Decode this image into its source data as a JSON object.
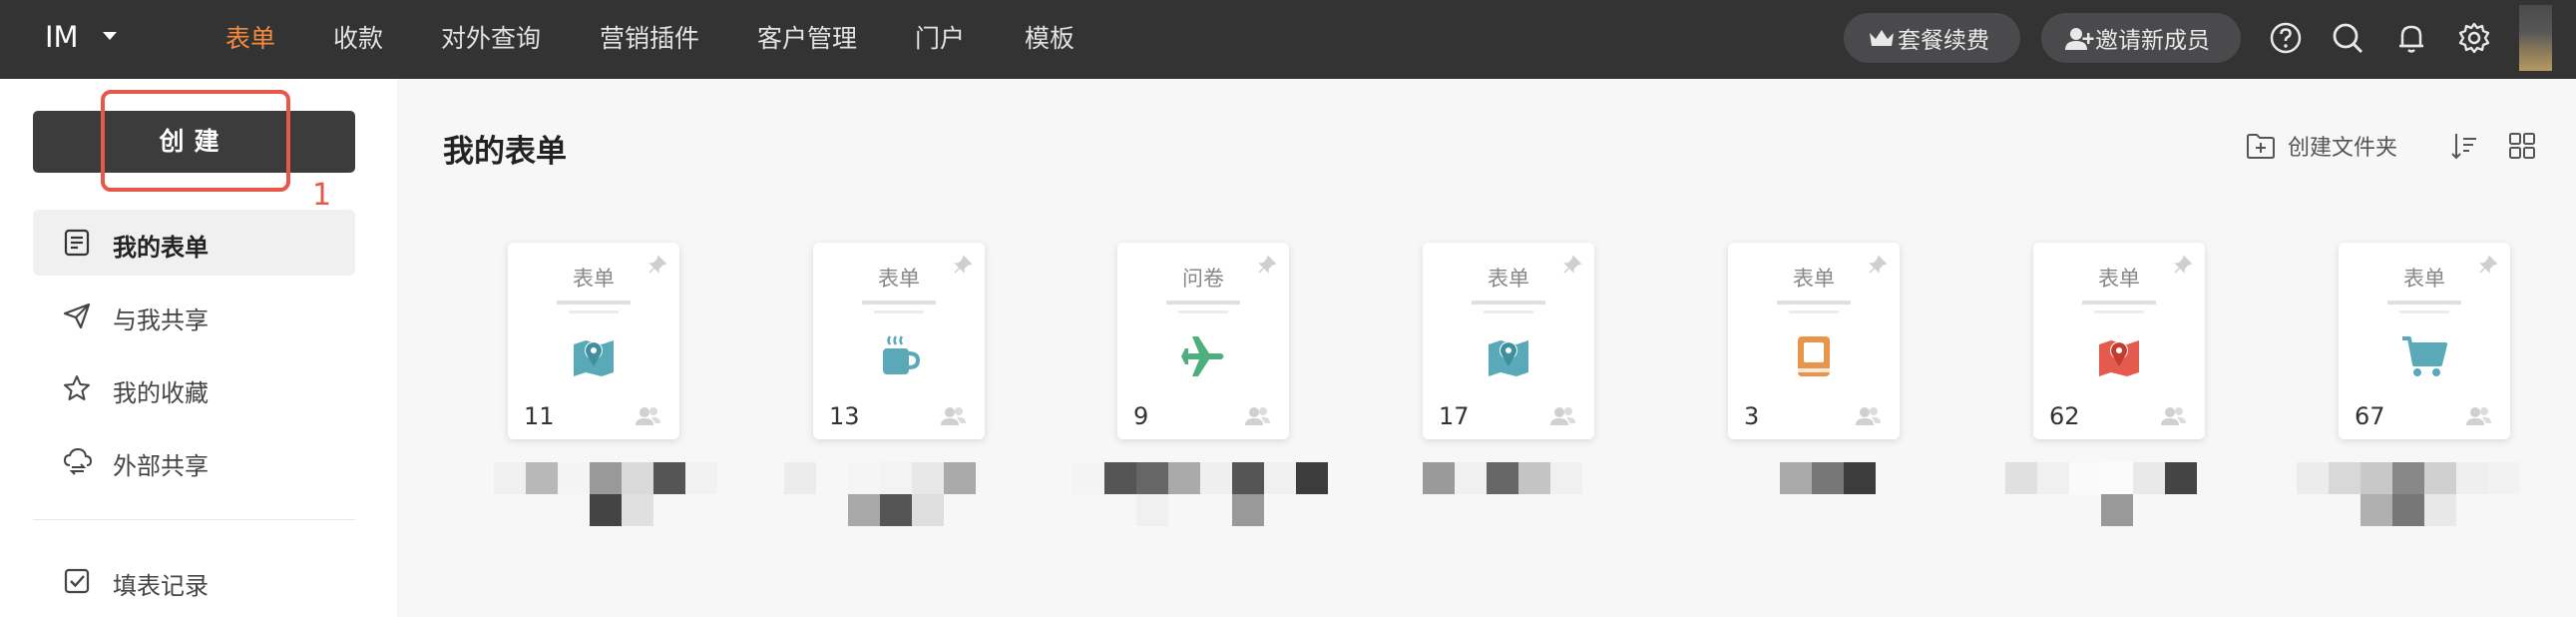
{
  "topbar": {
    "brand": "IM",
    "nav": [
      {
        "label": "表单",
        "active": true
      },
      {
        "label": "收款",
        "active": false
      },
      {
        "label": "对外查询",
        "active": false
      },
      {
        "label": "营销插件",
        "active": false
      },
      {
        "label": "客户管理",
        "active": false
      },
      {
        "label": "门户",
        "active": false
      },
      {
        "label": "模板",
        "active": false
      }
    ],
    "plan_button": "套餐续费",
    "invite_button": "邀请新成员",
    "accent_color": "#f58a3f"
  },
  "sidebar": {
    "create_button": "创建",
    "annotation_number": "1",
    "items": [
      {
        "label": "我的表单",
        "icon": "form-list-icon",
        "active": true
      },
      {
        "label": "与我共享",
        "icon": "send-icon",
        "active": false
      },
      {
        "label": "我的收藏",
        "icon": "star-icon",
        "active": false
      },
      {
        "label": "外部共享",
        "icon": "cloud-share-icon",
        "active": false
      },
      {
        "label": "填表记录",
        "icon": "checkbox-icon",
        "active": false
      }
    ]
  },
  "main": {
    "title": "我的表单",
    "create_folder": "创建文件夹",
    "cards": [
      {
        "type": "表单",
        "count": "11",
        "icon": "map-pin-icon",
        "color": "#5aa9b8"
      },
      {
        "type": "表单",
        "count": "13",
        "icon": "coffee-icon",
        "color": "#5aa9b8"
      },
      {
        "type": "问卷",
        "count": "9",
        "icon": "airplane-icon",
        "color": "#4caf7d"
      },
      {
        "type": "表单",
        "count": "17",
        "icon": "map-pin-icon",
        "color": "#5aa9b8"
      },
      {
        "type": "表单",
        "count": "3",
        "icon": "book-icon",
        "color": "#e8954c"
      },
      {
        "type": "表单",
        "count": "62",
        "icon": "map-pin-icon",
        "color": "#e45a4c"
      },
      {
        "type": "表单",
        "count": "67",
        "icon": "cart-icon",
        "color": "#5aa9b8"
      }
    ]
  }
}
